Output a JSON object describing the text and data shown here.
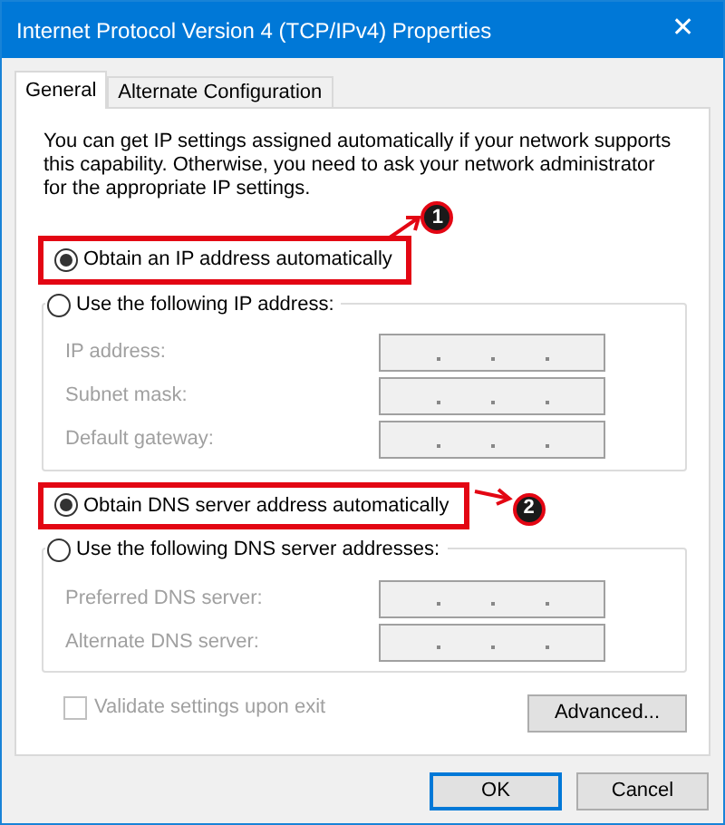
{
  "window": {
    "title": "Internet Protocol Version 4 (TCP/IPv4) Properties",
    "close_glyph": "✕"
  },
  "tabs": [
    {
      "label": "General",
      "selected": true
    },
    {
      "label": "Alternate Configuration",
      "selected": false
    }
  ],
  "intro": "You can get IP settings assigned automatically if your network supports this capability. Otherwise, you need to ask your network administrator for the appropriate IP settings.",
  "sections": [
    {
      "auto": {
        "label": "Obtain an IP address automatically",
        "selected": true,
        "highlighted": true,
        "callout": "1"
      },
      "manual": {
        "label": "Use the following IP address:",
        "selected": false
      },
      "fields": [
        {
          "label": "IP address:",
          "disabled": true
        },
        {
          "label": "Subnet mask:",
          "disabled": true
        },
        {
          "label": "Default gateway:",
          "disabled": true
        }
      ]
    },
    {
      "auto": {
        "label": "Obtain DNS server address automatically",
        "selected": true,
        "highlighted": true,
        "callout": "2"
      },
      "manual": {
        "label": "Use the following DNS server addresses:",
        "selected": false
      },
      "fields": [
        {
          "label": "Preferred DNS server:",
          "disabled": true
        },
        {
          "label": "Alternate DNS server:",
          "disabled": true
        }
      ]
    }
  ],
  "validate": {
    "label": "Validate settings upon exit",
    "checked": false,
    "disabled": true
  },
  "advanced_button": "Advanced...",
  "buttons": [
    {
      "label": "OK",
      "default": true
    },
    {
      "label": "Cancel",
      "default": false
    }
  ]
}
